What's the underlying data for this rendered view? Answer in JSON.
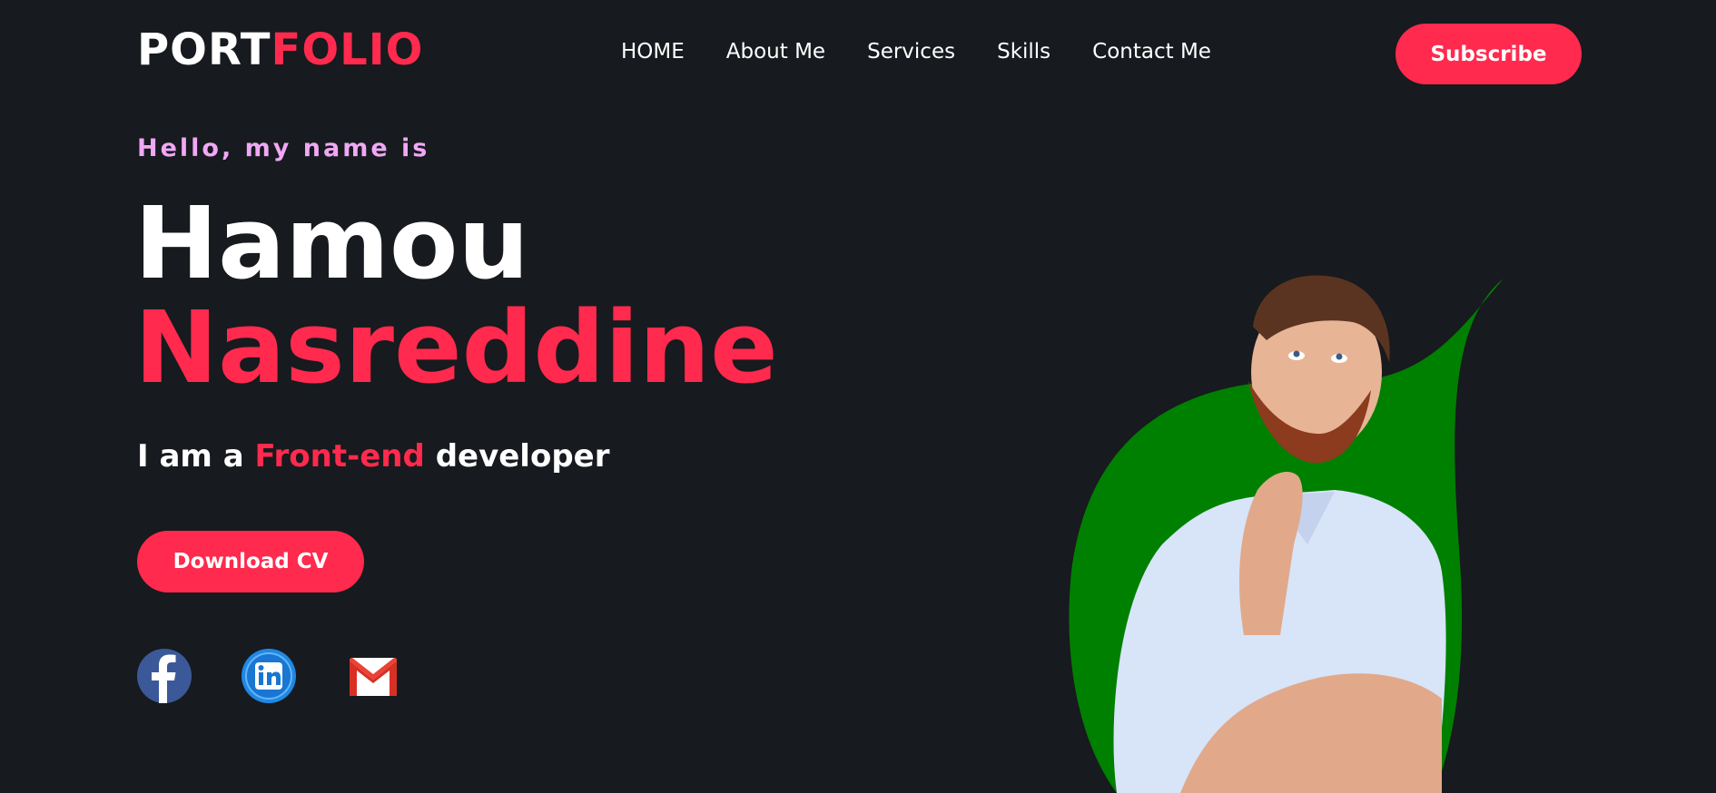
{
  "logo": {
    "part1": "PORT",
    "part2": "FOLIO"
  },
  "nav": {
    "items": [
      {
        "label": "HOME"
      },
      {
        "label": "About Me"
      },
      {
        "label": "Services"
      },
      {
        "label": "Skills"
      },
      {
        "label": "Contact Me"
      }
    ]
  },
  "header": {
    "subscribe_label": "Subscribe"
  },
  "hero": {
    "greeting": "Hello, my name is",
    "first_name": "Hamou",
    "last_name": "Nasreddine",
    "role_prefix": "I am a",
    "role_highlight": "Front-end",
    "role_suffix": "developer",
    "download_label": "Download CV"
  },
  "social": {
    "icons": [
      "facebook-icon",
      "linkedin-icon",
      "gmail-icon"
    ]
  },
  "colors": {
    "background": "#171a1e",
    "accent": "#ff2a4d",
    "greeting": "#f0a8f5",
    "leaf": "#008000",
    "facebook": "#3b5998",
    "linkedin": "#1e88e5"
  }
}
